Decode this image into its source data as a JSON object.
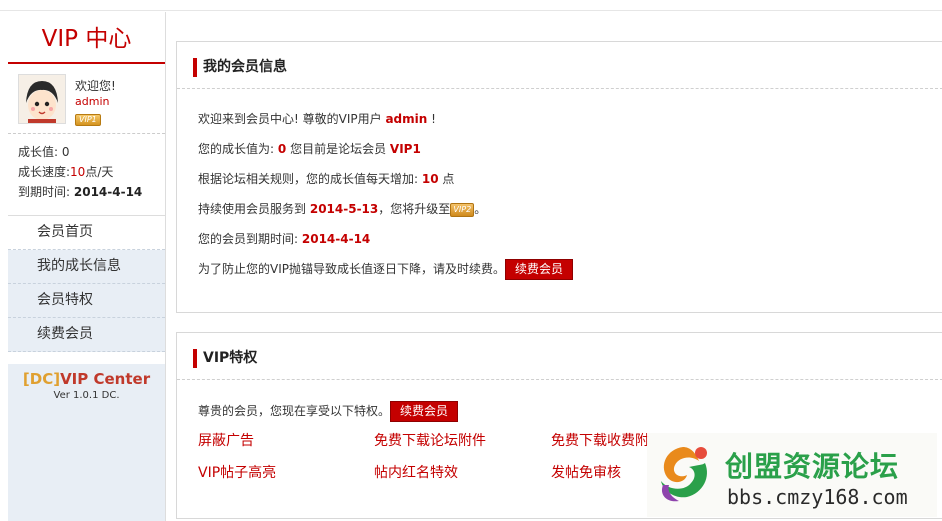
{
  "sidebar": {
    "title": "VIP 中心",
    "welcome": "欢迎您!",
    "username": "admin",
    "badge": "VIP1",
    "growth_label": "成长值:",
    "growth_value": "0",
    "speed_label": "成长速度:",
    "speed_value": "10",
    "speed_unit": "点/天",
    "expiry_label": "到期时间:",
    "expiry_value": "2014-4-14",
    "menu": [
      {
        "label": "会员首页"
      },
      {
        "label": "我的成长信息"
      },
      {
        "label": "会员特权"
      },
      {
        "label": "续费会员"
      }
    ],
    "brand_dc": "[DC]",
    "brand_name": "VIP Center",
    "version": "Ver 1.0.1 DC."
  },
  "info_panel": {
    "title": "我的会员信息",
    "l1_pre": "欢迎来到会员中心! 尊敬的VIP用户",
    "l1_user": "admin",
    "l1_post": "!",
    "l2_pre": "您的成长值为:",
    "l2_val": "0",
    "l2_mid": "您目前是论坛会员",
    "l2_level": "VIP1",
    "l3_pre": "根据论坛相关规则，您的成长值每天增加:",
    "l3_val": "10",
    "l3_post": "点",
    "l4_pre": "持续使用会员服务到",
    "l4_date": "2014-5-13",
    "l4_mid": "，您将升级至",
    "l4_badge": "VIP2",
    "l4_post": "。",
    "l5_pre": "您的会员到期时间:",
    "l5_date": "2014-4-14",
    "l6_text": "为了防止您的VIP抛锚导致成长值逐日下降，请及时续费。",
    "renew_label": "续费会员"
  },
  "privilege_panel": {
    "title": "VIP特权",
    "intro": "尊贵的会员，您现在享受以下特权。",
    "renew_label": "续费会员",
    "items": [
      {
        "label": "屏蔽广告"
      },
      {
        "label": "免费下载论坛附件"
      },
      {
        "label": "免费下载收费附"
      },
      {
        "label": "VIP帖子高亮"
      },
      {
        "label": "帖内红名特效"
      },
      {
        "label": "发帖免审核"
      }
    ]
  },
  "watermark": {
    "name": "创盟资源论坛",
    "url": "bbs.cmzy168.com"
  },
  "colors": {
    "accent": "#c40000",
    "menu_bg": "#e8eef5",
    "brand_gold": "#e0a030"
  }
}
